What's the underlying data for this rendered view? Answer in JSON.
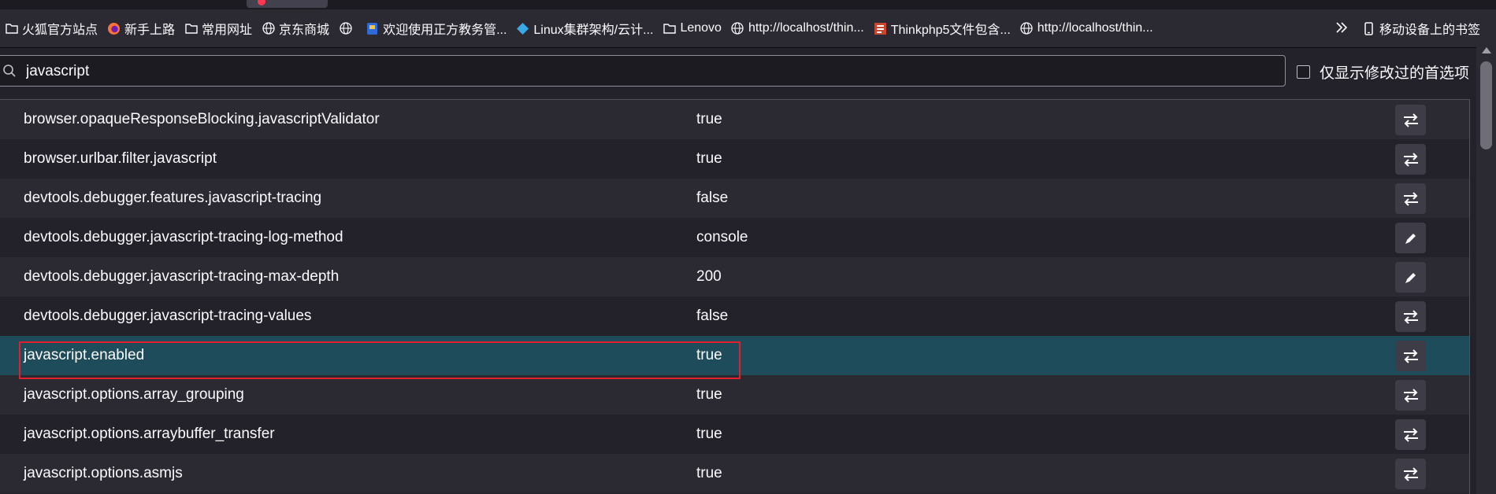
{
  "bookmarks": {
    "items": [
      {
        "label": "火狐官方站点",
        "icon": "folder-icon"
      },
      {
        "label": "新手上路",
        "icon": "firefox-icon"
      },
      {
        "label": "常用网址",
        "icon": "folder-icon"
      },
      {
        "label": "京东商城",
        "icon": "globe-icon"
      },
      {
        "label": "",
        "icon": "globe-icon"
      },
      {
        "label": "欢迎使用正方教务管...",
        "icon": "app-icon"
      },
      {
        "label": "Linux集群架构/云计...",
        "icon": "diamond-icon"
      },
      {
        "label": "Lenovo",
        "icon": "folder-icon"
      },
      {
        "label": "http://localhost/thin...",
        "icon": "globe-icon"
      },
      {
        "label": "Thinkphp5文件包含...",
        "icon": "thinkphp-icon"
      },
      {
        "label": "http://localhost/thin...",
        "icon": "globe-icon"
      }
    ],
    "overflow_icon": "chevron-double-right-icon",
    "mobile_label": "移动设备上的书签"
  },
  "search": {
    "value": "javascript",
    "modified_only_label": "仅显示修改过的首选项"
  },
  "prefs": [
    {
      "name": "browser.opaqueResponseBlocking.javascriptValidator",
      "value": "true",
      "action": "toggle-icon"
    },
    {
      "name": "browser.urlbar.filter.javascript",
      "value": "true",
      "action": "toggle-icon"
    },
    {
      "name": "devtools.debugger.features.javascript-tracing",
      "value": "false",
      "action": "toggle-icon"
    },
    {
      "name": "devtools.debugger.javascript-tracing-log-method",
      "value": "console",
      "action": "edit-icon"
    },
    {
      "name": "devtools.debugger.javascript-tracing-max-depth",
      "value": "200",
      "action": "edit-icon"
    },
    {
      "name": "devtools.debugger.javascript-tracing-values",
      "value": "false",
      "action": "toggle-icon"
    },
    {
      "name": "javascript.enabled",
      "value": "true",
      "action": "toggle-icon",
      "selected": true
    },
    {
      "name": "javascript.options.array_grouping",
      "value": "true",
      "action": "toggle-icon"
    },
    {
      "name": "javascript.options.arraybuffer_transfer",
      "value": "true",
      "action": "toggle-icon"
    },
    {
      "name": "javascript.options.asmjs",
      "value": "true",
      "action": "toggle-icon"
    }
  ],
  "colors": {
    "selected_row": "#1f4c5a",
    "highlight_border": "#e0202c"
  }
}
